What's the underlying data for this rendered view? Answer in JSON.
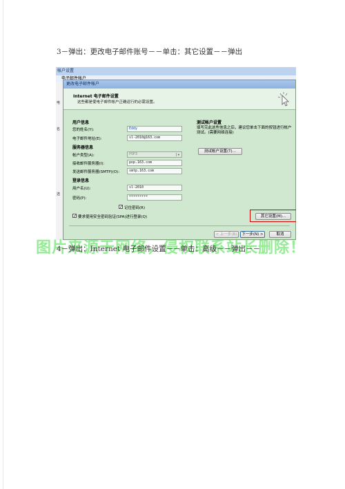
{
  "step3": "3－弹出：更改电子邮件账号－－单击：其它设置－－弹出",
  "step4": "4－弹出：Internet 电子邮件设置－－单击：高级－－弹出－－",
  "background_window": {
    "title": "帐户设置",
    "subtitle": "电子邮件帐户",
    "left_texts": [
      "电",
      "名",
      "选"
    ]
  },
  "dialog": {
    "title": "更改电子邮件帐户",
    "header_title": "Internet 电子邮件设置",
    "header_sub": "这些都是使电子邮件帐户正确运行的必需设置。",
    "user_info_heading": "用户信息",
    "name_label": "您的姓名(Y):",
    "name_value": "Eddy",
    "email_label": "电子邮件地址(E):",
    "email_value": "sl-2010@163.com",
    "server_heading": "服务器信息",
    "account_type_label": "帐户类型(A):",
    "account_type_value": "POP3",
    "incoming_label": "接收邮件服务器(I):",
    "incoming_value": "pop.163.com",
    "outgoing_label": "发送邮件服务器(SMTP)(O):",
    "outgoing_value": "smtp.163.com",
    "login_heading": "登录信息",
    "username_label": "用户名(U):",
    "username_value": "sl-2010",
    "password_label": "密码(P):",
    "password_value": "*********",
    "remember_label": "记住密码(R)",
    "spa_label": "要求使用安全密码验证(SPA)进行登录(Q)",
    "test_heading": "测试帐户设置",
    "test_desc": "填写完此这些信息之后，建议您单击下面的按钮进行帐户测试。(需要网络连接)",
    "test_button": "测试帐户设置(T)...",
    "more_settings_button": "其它设置(M)...",
    "back_button": "< 上一步(B)",
    "next_button": "下一步(N) >",
    "cancel_button": "取消"
  },
  "watermark": "图片来源于网络，侵权联系站长删除！",
  "colors": {
    "dialog_bg": "#cfe8cf",
    "highlight": "#d00000",
    "watermark": "#40dc40"
  }
}
